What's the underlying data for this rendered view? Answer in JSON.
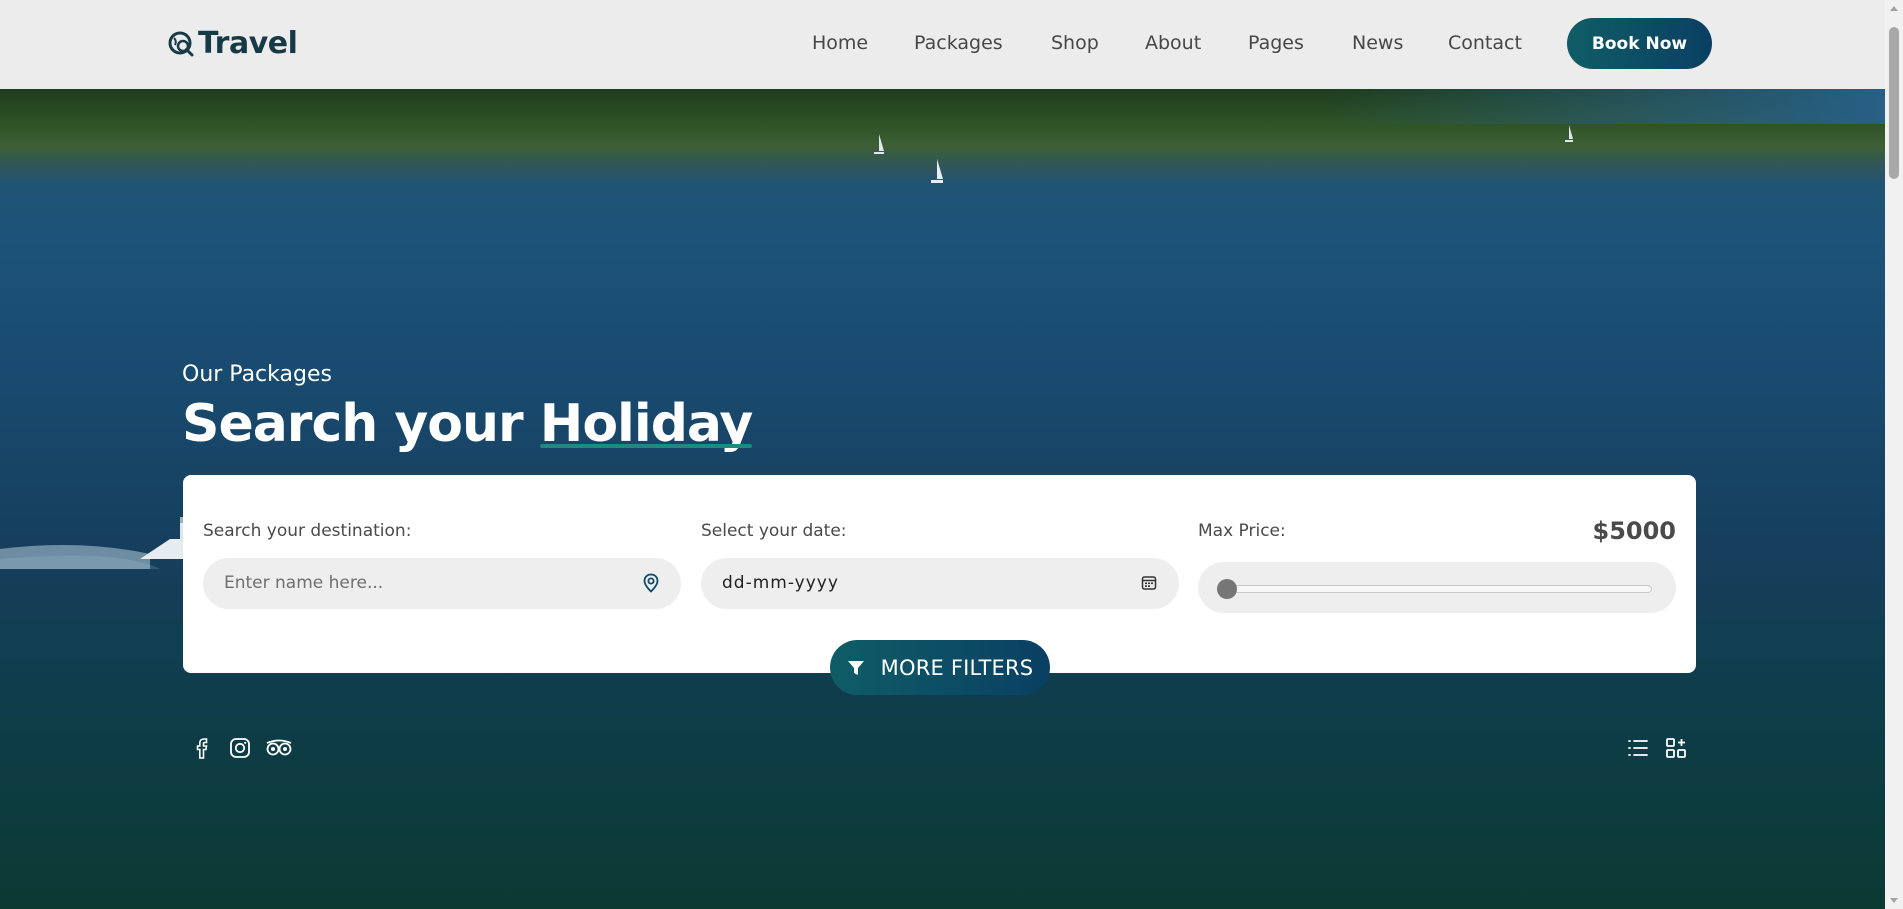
{
  "header": {
    "logo_text": "Travel",
    "nav": [
      "Home",
      "Packages",
      "Shop",
      "About",
      "Pages",
      "News",
      "Contact"
    ],
    "book_label": "Book Now"
  },
  "hero": {
    "subtitle": "Our Packages",
    "title_prefix": "Search your ",
    "title_highlight": "Holiday"
  },
  "search": {
    "destination_label": "Search your destination:",
    "destination_placeholder": "Enter name here...",
    "date_label": "Select your date:",
    "date_value": "dd-mm-yyyy",
    "price_label": "Max Price:",
    "price_value": "$5000",
    "price_slider_fraction": 0,
    "more_filters_label": "MORE FILTERS"
  },
  "social_icons": [
    "facebook-icon",
    "instagram-icon",
    "tripadvisor-icon"
  ],
  "view_icons": [
    "list-view-icon",
    "grid-view-icon"
  ],
  "colors": {
    "brand_dark": "#163a46",
    "button_gradient_start": "#0f5d66",
    "button_gradient_end": "#0a3f63",
    "highlight_underline": "#1f8a7e"
  }
}
